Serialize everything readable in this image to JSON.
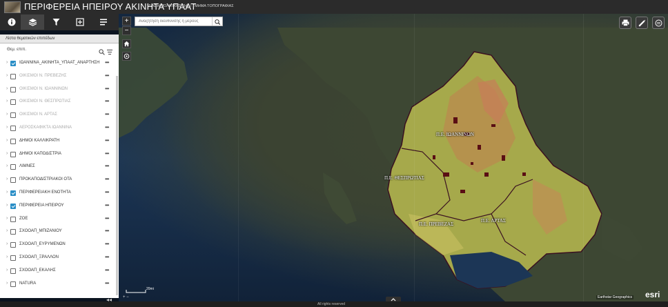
{
  "app": {
    "title": "ΠΕΡΙΦΕΡΕΙΑ ΗΠΕΙΡΟΥ ΑΚΙΝΗΤΑ ΥΠΑΑΤ",
    "subtitle": "Δ/ΝΣΗ ΠΟΛΙΤΙΚΗΣ ΓΗΣ / ΤΜΗΜΑ ΤΟΠΟΓΡΑΦΙΑΣ"
  },
  "toolbar": {
    "tools": [
      "info-icon",
      "layers-icon",
      "filter-icon",
      "select-icon",
      "legend-icon"
    ]
  },
  "panel": {
    "header": "Λίστα θεματικών επιπέδων",
    "sublabel": "Θεμ. επιπ."
  },
  "layers": [
    {
      "label": "ΙΩΑΝΝΙΝΑ_ΑΚΙΝΗΤΑ_ΥΠΑΑΤ_ΑΝΑΡΤΗΣΗ",
      "checked": true,
      "dim": false
    },
    {
      "label": "ΟΙΚΙΣΜΟΙ Ν. ΠΡΕΒΕΖΗΣ",
      "checked": false,
      "dim": true
    },
    {
      "label": "ΟΙΚΙΣΜΟΙ Ν. ΙΩΑΝΝΙΝΩΝ",
      "checked": false,
      "dim": true
    },
    {
      "label": "ΟΙΚΙΣΜΟΙ Ν. ΘΕΣΠΡΩΤΙΑΣ",
      "checked": false,
      "dim": true
    },
    {
      "label": "ΟΙΚΙΣΜΟΙ Ν. ΑΡΤΑΣ",
      "checked": false,
      "dim": true
    },
    {
      "label": "ΑΕΡΟΣΚΑΦΙΚΤΑ ΙΩΑΝΝΙΝΑ",
      "checked": false,
      "dim": true
    },
    {
      "label": "ΔΗΜΟΙ ΚΑΛΛΙΚΡΑΤΗ",
      "checked": false,
      "dim": false
    },
    {
      "label": "ΔΗΜΟΙ ΚΑΠΟΔΙΣΤΡΙΑ",
      "checked": false,
      "dim": false
    },
    {
      "label": "ΛΙΜΝΕΣ",
      "checked": false,
      "dim": false
    },
    {
      "label": "ΠΡΟΚΑΠΟΔΙΣΤΡΙΑΚΟΙ ΟΤΑ",
      "checked": false,
      "dim": false
    },
    {
      "label": "ΠΕΡΙΦΕΡΕΙΑΚΗ ΕΝΟΤΗΤΑ",
      "checked": true,
      "dim": false
    },
    {
      "label": "ΠΕΡΙΦΕΡΕΙΑ ΗΠΕΙΡΟΥ",
      "checked": true,
      "dim": false
    },
    {
      "label": "ZOE",
      "checked": false,
      "dim": false
    },
    {
      "label": "ΣΧΟΟΑΠ_ΜΠΙΖΑΝΙΟΥ",
      "checked": false,
      "dim": false
    },
    {
      "label": "ΣΧΟΟΑΠ_ΕΥΡΥΜΕΝΩΝ",
      "checked": false,
      "dim": false
    },
    {
      "label": "ΣΧΟΟΑΠ_ΞΡΑΛΛΟΝ",
      "checked": false,
      "dim": false
    },
    {
      "label": "ΣΧΟΟΑΠ_ΕΚΑΛΗΣ",
      "checked": false,
      "dim": false
    },
    {
      "label": "NATURA",
      "checked": false,
      "dim": false
    }
  ],
  "search": {
    "placeholder": "Αναζήτηση διεύθυνσης ή μέρους"
  },
  "map": {
    "regions": [
      "Π.Ε. ΙΩΑΝΝΙΝΩΝ",
      "Π.Ε. ΘΕΣΠΡΩΤΙΑΣ",
      "Π.Ε. ΠΡΕΒΕΖΑΣ",
      "Π.Ε. ΑΡΤΑΣ"
    ],
    "scale": "20mi",
    "attribution": "Earthstar Geographics",
    "logo": "esri"
  },
  "footer": {
    "rights": "All rights reserved"
  },
  "colors": {
    "accent": "#2a8ec6",
    "topbar": "#2b2b2b",
    "region_border": "#3a1020"
  }
}
